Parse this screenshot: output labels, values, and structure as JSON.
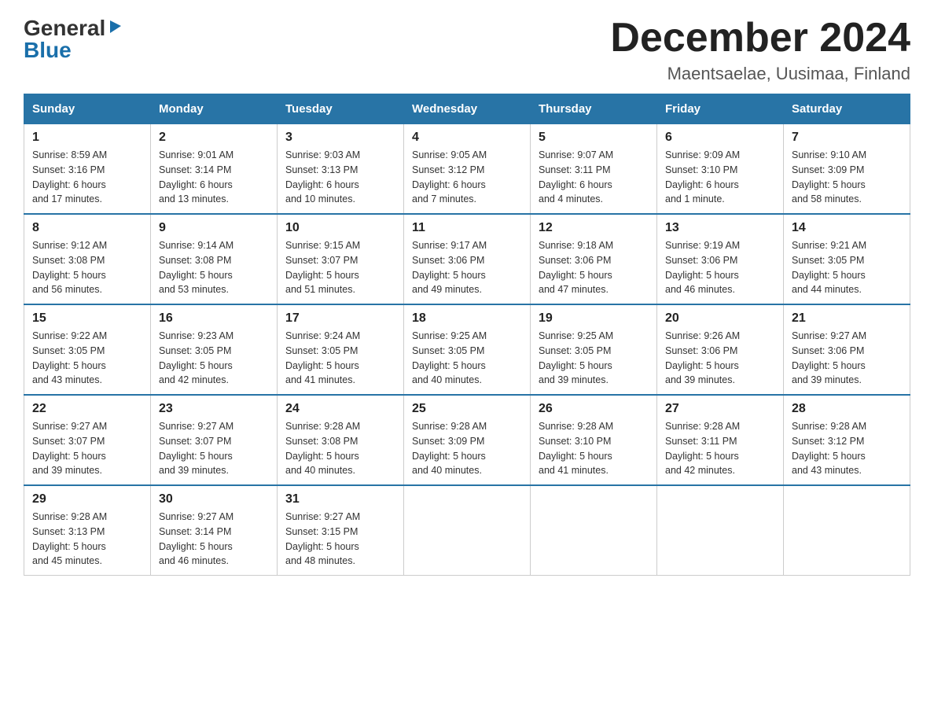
{
  "logo": {
    "text_general": "General",
    "text_blue": "Blue",
    "arrow_symbol": "▶"
  },
  "title": "December 2024",
  "subtitle": "Maentsaelae, Uusimaa, Finland",
  "days_of_week": [
    "Sunday",
    "Monday",
    "Tuesday",
    "Wednesday",
    "Thursday",
    "Friday",
    "Saturday"
  ],
  "weeks": [
    [
      {
        "day": "1",
        "sunrise": "8:59 AM",
        "sunset": "3:16 PM",
        "daylight": "6 hours and 17 minutes."
      },
      {
        "day": "2",
        "sunrise": "9:01 AM",
        "sunset": "3:14 PM",
        "daylight": "6 hours and 13 minutes."
      },
      {
        "day": "3",
        "sunrise": "9:03 AM",
        "sunset": "3:13 PM",
        "daylight": "6 hours and 10 minutes."
      },
      {
        "day": "4",
        "sunrise": "9:05 AM",
        "sunset": "3:12 PM",
        "daylight": "6 hours and 7 minutes."
      },
      {
        "day": "5",
        "sunrise": "9:07 AM",
        "sunset": "3:11 PM",
        "daylight": "6 hours and 4 minutes."
      },
      {
        "day": "6",
        "sunrise": "9:09 AM",
        "sunset": "3:10 PM",
        "daylight": "6 hours and 1 minute."
      },
      {
        "day": "7",
        "sunrise": "9:10 AM",
        "sunset": "3:09 PM",
        "daylight": "5 hours and 58 minutes."
      }
    ],
    [
      {
        "day": "8",
        "sunrise": "9:12 AM",
        "sunset": "3:08 PM",
        "daylight": "5 hours and 56 minutes."
      },
      {
        "day": "9",
        "sunrise": "9:14 AM",
        "sunset": "3:08 PM",
        "daylight": "5 hours and 53 minutes."
      },
      {
        "day": "10",
        "sunrise": "9:15 AM",
        "sunset": "3:07 PM",
        "daylight": "5 hours and 51 minutes."
      },
      {
        "day": "11",
        "sunrise": "9:17 AM",
        "sunset": "3:06 PM",
        "daylight": "5 hours and 49 minutes."
      },
      {
        "day": "12",
        "sunrise": "9:18 AM",
        "sunset": "3:06 PM",
        "daylight": "5 hours and 47 minutes."
      },
      {
        "day": "13",
        "sunrise": "9:19 AM",
        "sunset": "3:06 PM",
        "daylight": "5 hours and 46 minutes."
      },
      {
        "day": "14",
        "sunrise": "9:21 AM",
        "sunset": "3:05 PM",
        "daylight": "5 hours and 44 minutes."
      }
    ],
    [
      {
        "day": "15",
        "sunrise": "9:22 AM",
        "sunset": "3:05 PM",
        "daylight": "5 hours and 43 minutes."
      },
      {
        "day": "16",
        "sunrise": "9:23 AM",
        "sunset": "3:05 PM",
        "daylight": "5 hours and 42 minutes."
      },
      {
        "day": "17",
        "sunrise": "9:24 AM",
        "sunset": "3:05 PM",
        "daylight": "5 hours and 41 minutes."
      },
      {
        "day": "18",
        "sunrise": "9:25 AM",
        "sunset": "3:05 PM",
        "daylight": "5 hours and 40 minutes."
      },
      {
        "day": "19",
        "sunrise": "9:25 AM",
        "sunset": "3:05 PM",
        "daylight": "5 hours and 39 minutes."
      },
      {
        "day": "20",
        "sunrise": "9:26 AM",
        "sunset": "3:06 PM",
        "daylight": "5 hours and 39 minutes."
      },
      {
        "day": "21",
        "sunrise": "9:27 AM",
        "sunset": "3:06 PM",
        "daylight": "5 hours and 39 minutes."
      }
    ],
    [
      {
        "day": "22",
        "sunrise": "9:27 AM",
        "sunset": "3:07 PM",
        "daylight": "5 hours and 39 minutes."
      },
      {
        "day": "23",
        "sunrise": "9:27 AM",
        "sunset": "3:07 PM",
        "daylight": "5 hours and 39 minutes."
      },
      {
        "day": "24",
        "sunrise": "9:28 AM",
        "sunset": "3:08 PM",
        "daylight": "5 hours and 40 minutes."
      },
      {
        "day": "25",
        "sunrise": "9:28 AM",
        "sunset": "3:09 PM",
        "daylight": "5 hours and 40 minutes."
      },
      {
        "day": "26",
        "sunrise": "9:28 AM",
        "sunset": "3:10 PM",
        "daylight": "5 hours and 41 minutes."
      },
      {
        "day": "27",
        "sunrise": "9:28 AM",
        "sunset": "3:11 PM",
        "daylight": "5 hours and 42 minutes."
      },
      {
        "day": "28",
        "sunrise": "9:28 AM",
        "sunset": "3:12 PM",
        "daylight": "5 hours and 43 minutes."
      }
    ],
    [
      {
        "day": "29",
        "sunrise": "9:28 AM",
        "sunset": "3:13 PM",
        "daylight": "5 hours and 45 minutes."
      },
      {
        "day": "30",
        "sunrise": "9:27 AM",
        "sunset": "3:14 PM",
        "daylight": "5 hours and 46 minutes."
      },
      {
        "day": "31",
        "sunrise": "9:27 AM",
        "sunset": "3:15 PM",
        "daylight": "5 hours and 48 minutes."
      },
      null,
      null,
      null,
      null
    ]
  ],
  "labels": {
    "sunrise": "Sunrise: ",
    "sunset": "Sunset: ",
    "daylight": "Daylight: "
  }
}
